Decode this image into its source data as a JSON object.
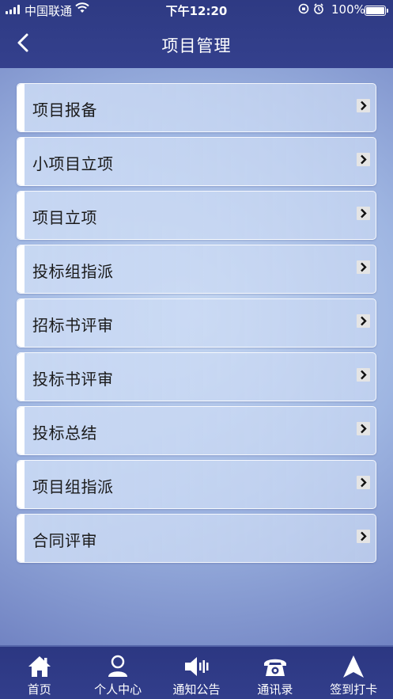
{
  "status_bar": {
    "carrier": "中国联通",
    "time": "下午12:20",
    "battery": "100%",
    "battery_level": 1.0
  },
  "header": {
    "title": "项目管理"
  },
  "menu": [
    {
      "label": "项目报备"
    },
    {
      "label": "小项目立项"
    },
    {
      "label": "项目立项"
    },
    {
      "label": "投标组指派"
    },
    {
      "label": "招标书评审"
    },
    {
      "label": "投标书评审"
    },
    {
      "label": "投标总结"
    },
    {
      "label": "项目组指派"
    },
    {
      "label": "合同评审"
    }
  ],
  "tabs": [
    {
      "label": "首页",
      "icon": "home-icon"
    },
    {
      "label": "个人中心",
      "icon": "person-icon"
    },
    {
      "label": "通知公告",
      "icon": "speaker-icon"
    },
    {
      "label": "通讯录",
      "icon": "telephone-icon"
    },
    {
      "label": "签到打卡",
      "icon": "navigation-arrow-icon"
    }
  ],
  "colors": {
    "header_bg": "#2e3a83",
    "tabbar_bg": "#2c3782",
    "item_text": "#1a1a1a"
  }
}
